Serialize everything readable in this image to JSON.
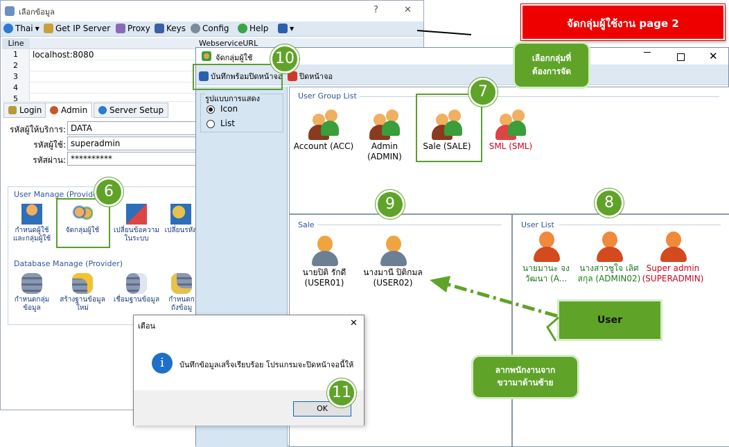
{
  "back_window": {
    "title": "เลือกข้อมูล",
    "help_mark": "?",
    "close_mark": "✕",
    "toolbar": {
      "lang": "Thai",
      "get_ip": "Get IP Server",
      "proxy": "Proxy",
      "keys": "Keys",
      "config": "Config",
      "help": "Help"
    },
    "grid": {
      "col_line": "Line",
      "col_url": "WebserviceURL",
      "rows": [
        {
          "n": "1",
          "url": "localhost:8080"
        },
        {
          "n": "2",
          "url": ""
        },
        {
          "n": "3",
          "url": ""
        },
        {
          "n": "4",
          "url": ""
        },
        {
          "n": "5",
          "url": ""
        }
      ]
    },
    "tabs": {
      "login": "Login",
      "admin": "Admin",
      "server_setup": "Server Setup"
    },
    "form": {
      "provider_label": "รหัสผู้ให้บริการ:",
      "provider_value": "DATA",
      "user_label": "รหัสผู้ใช้:",
      "user_value": "superadmin",
      "pass_label": "รหัสผ่าน:",
      "pass_value": "**********"
    },
    "user_manage": {
      "title": "User Manage (Provider)",
      "items": [
        "กำหนดผู้ใช้\nและกลุ่มผู้ใช้",
        "จัดกลุ่มผู้ใช้",
        "เปลี่ยนข้อความ\nในระบบ",
        "เปลี่ยนรหัส"
      ]
    },
    "db_manage": {
      "title": "Database Manage (Provider)",
      "items": [
        "กำหนดกลุ่ม\nข้อมูล",
        "สร้างฐานข้อมูล\nใหม่",
        "เชื่อมฐานข้อมูล\n",
        "กำหนดก\nถังข้อมู"
      ]
    }
  },
  "front_window": {
    "title": "จัดกลุ่มผู้ใช้",
    "toolbar": {
      "save_close": "บันทึกพร้อมปิดหน้าจอ",
      "close": "ปิดหน้าจอ"
    },
    "display": {
      "title": "รูปแบบการแสดง",
      "icon": "Icon",
      "list": "List"
    },
    "group_list": {
      "title": "User Group List",
      "items": [
        {
          "label": "Account (ACC)",
          "color": "#000000"
        },
        {
          "label": "Admin (ADMIN)",
          "color": "#000000"
        },
        {
          "label": "Sale (SALE)",
          "color": "#000000"
        },
        {
          "label": "SML (SML)",
          "color": "#d0021b"
        }
      ]
    },
    "sale": {
      "title": "Sale",
      "users": [
        {
          "name": "นายปิติ รักดี",
          "code": "(USER01)"
        },
        {
          "name": "นางมานี ปิติกมล",
          "code": "(USER02)"
        }
      ]
    },
    "user_list": {
      "title": "User List",
      "users": [
        {
          "name": "นายมานะ จง",
          "code": "วัฒนา (A...",
          "color": "#1e7b1e"
        },
        {
          "name": "นางสาวชูใจ เลิศ",
          "code": "สกุล (ADMIN02)",
          "color": "#1e7b1e"
        },
        {
          "name": "Super admin",
          "code": "(SUPERADMIN)",
          "color": "#d0021b"
        }
      ]
    }
  },
  "dialog": {
    "title": "เตือน",
    "message": "บันทึกข้อมูลเสร็จเรียบร้อย โปรแกรมจะปิดหน้าจอนี้ให้",
    "ok": "OK",
    "close_mark": "✕"
  },
  "banner": {
    "text": "จัดกลุ่มผู้ใช้งาน page 2"
  },
  "callouts": {
    "select_group": "เลือกกลุ่มที่\nต้องการจัด",
    "user": "User",
    "drag": "ลากพนักงานจาก\nขวามาด้านซ้าย"
  },
  "badges": [
    "6",
    "7",
    "8",
    "9",
    "10",
    "11"
  ]
}
